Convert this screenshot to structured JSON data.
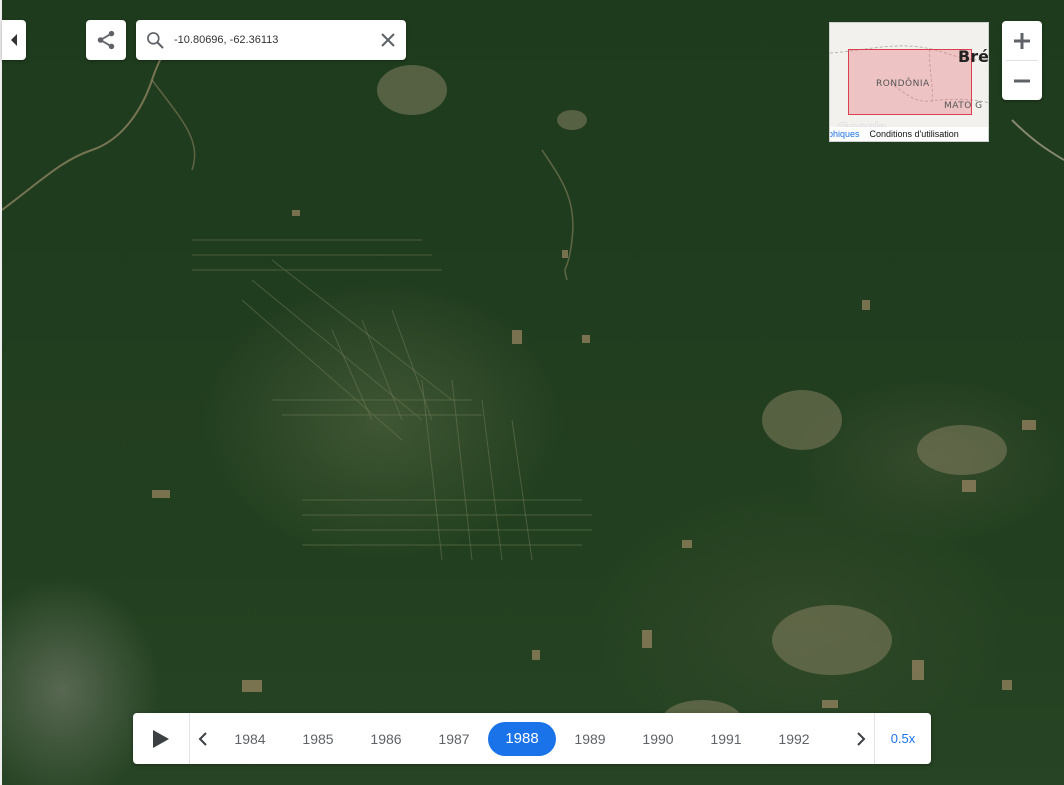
{
  "search": {
    "value": "-10.80696, -62.36113"
  },
  "minimap": {
    "country_label": "Bré",
    "state_label": "RONDÔNIA",
    "state2_label": "MATO G",
    "attribution_data": "phiques",
    "attribution_terms": "Conditions d'utilisation",
    "logo_text": "Google"
  },
  "timeline": {
    "years": [
      "1984",
      "1985",
      "1986",
      "1987",
      "1988",
      "1989",
      "1990",
      "1991",
      "1992"
    ],
    "selected_year": "1988",
    "speed_label": "0.5x"
  },
  "colors": {
    "accent": "#1a73e8",
    "region_fill": "#e87882",
    "region_border": "#d9404f"
  },
  "icons": [
    "collapse-left-icon",
    "share-icon",
    "search-icon",
    "close-icon",
    "plus-icon",
    "minus-icon",
    "play-icon",
    "chevron-left-icon",
    "chevron-right-icon"
  ]
}
